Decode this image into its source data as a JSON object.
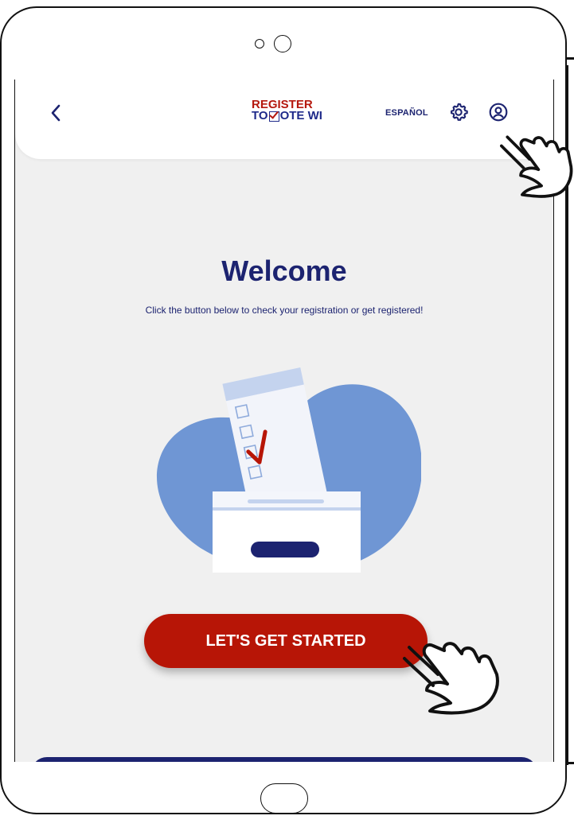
{
  "header": {
    "logo_line1": "REGISTER",
    "logo_line2_pre": "TO",
    "logo_line2_post": "OTE WI",
    "language_label": "ESPAÑOL",
    "icons": [
      "back-chevron-icon",
      "gear-icon",
      "user-profile-icon"
    ]
  },
  "main": {
    "title": "Welcome",
    "subtitle": "Click the button below to check your registration or get registered!",
    "cta_label": "LET'S GET STARTED"
  },
  "colors": {
    "brand_navy": "#1c2370",
    "brand_red": "#b71506",
    "blob_blue": "#6f96d4",
    "screen_bg": "#f0f0f0"
  },
  "annotations": [
    "tap-hand-icon",
    "tap-hand-icon"
  ]
}
